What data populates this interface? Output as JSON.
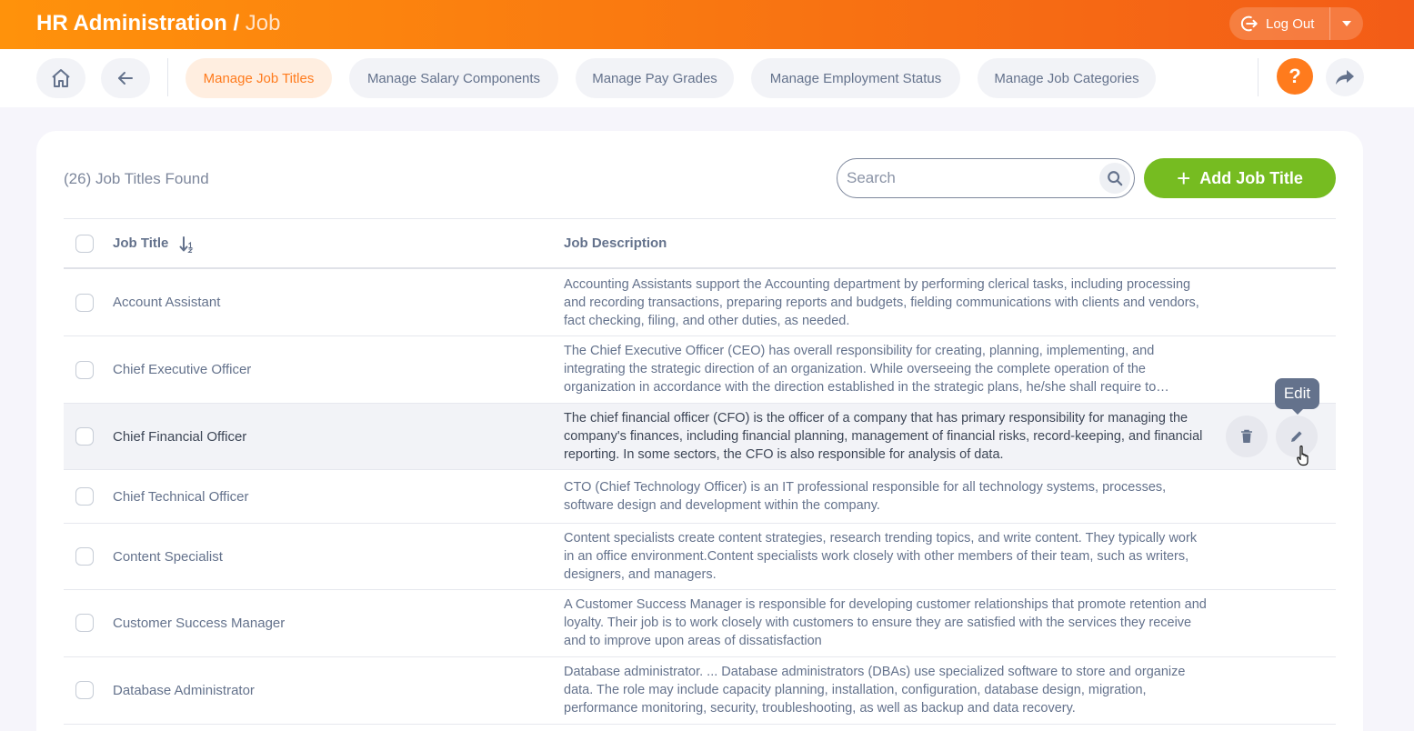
{
  "header": {
    "title": "HR Administration",
    "separator": "/",
    "subtitle": "Job",
    "logout_label": "Log Out"
  },
  "nav": {
    "tabs": [
      {
        "label": "Manage Job Titles",
        "active": true
      },
      {
        "label": "Manage Salary Components",
        "active": false
      },
      {
        "label": "Manage Pay Grades",
        "active": false
      },
      {
        "label": "Manage Employment Status",
        "active": false
      },
      {
        "label": "Manage Job Categories",
        "active": false
      }
    ],
    "help_label": "?"
  },
  "list": {
    "found_text": "(26) Job Titles Found",
    "search_placeholder": "Search",
    "add_button_label": "Add Job Title",
    "add_button_color": "#76bc21",
    "columns": {
      "title": "Job Title",
      "description": "Job Description"
    },
    "rows": [
      {
        "title": "Account Assistant",
        "description": "Accounting Assistants support the Accounting department by performing clerical tasks, including processing and recording transactions, preparing reports and budgets, fielding communications with clients and vendors, fact checking, filing, and other duties, as needed."
      },
      {
        "title": "Chief Executive Officer",
        "description": "The Chief Executive Officer (CEO) has overall responsibility for creating, planning, implementing, and integrating the strategic direction of an organization. While overseeing the complete operation of the organization in accordance with the direction established in the strategic plans, he/she shall require to…"
      },
      {
        "title": "Chief Financial Officer",
        "description": "The chief financial officer (CFO) is the officer of a company that has primary responsibility for managing the company's finances, including financial planning, management of financial risks, record-keeping, and financial reporting. In some sectors, the CFO is also responsible for analysis of data."
      },
      {
        "title": "Chief Technical Officer",
        "description": "CTO (Chief Technology Officer) is an IT professional responsible for all technology systems, processes, software design and development within the company."
      },
      {
        "title": "Content Specialist",
        "description": "Content specialists create content strategies, research trending topics, and write content. They typically work in an office environment.Content specialists work closely with other members of their team, such as writers, designers, and managers."
      },
      {
        "title": "Customer Success Manager",
        "description": "A Customer Success Manager is responsible for developing customer relationships that promote retention and loyalty. Their job is to work closely with customers to ensure they are satisfied with the services they receive and to improve upon areas of dissatisfaction"
      },
      {
        "title": "Database Administrator",
        "description": "Database administrator. ... Database administrators (DBAs) use specialized software to store and organize data. The role may include capacity planning, installation, configuration, database design, migration, performance monitoring, security, troubleshooting, as well as backup and data recovery."
      }
    ],
    "tooltip": "Edit"
  },
  "colors": {
    "accent": "#ff7b1d",
    "header_start": "#ff920b",
    "header_end": "#f35c17"
  }
}
